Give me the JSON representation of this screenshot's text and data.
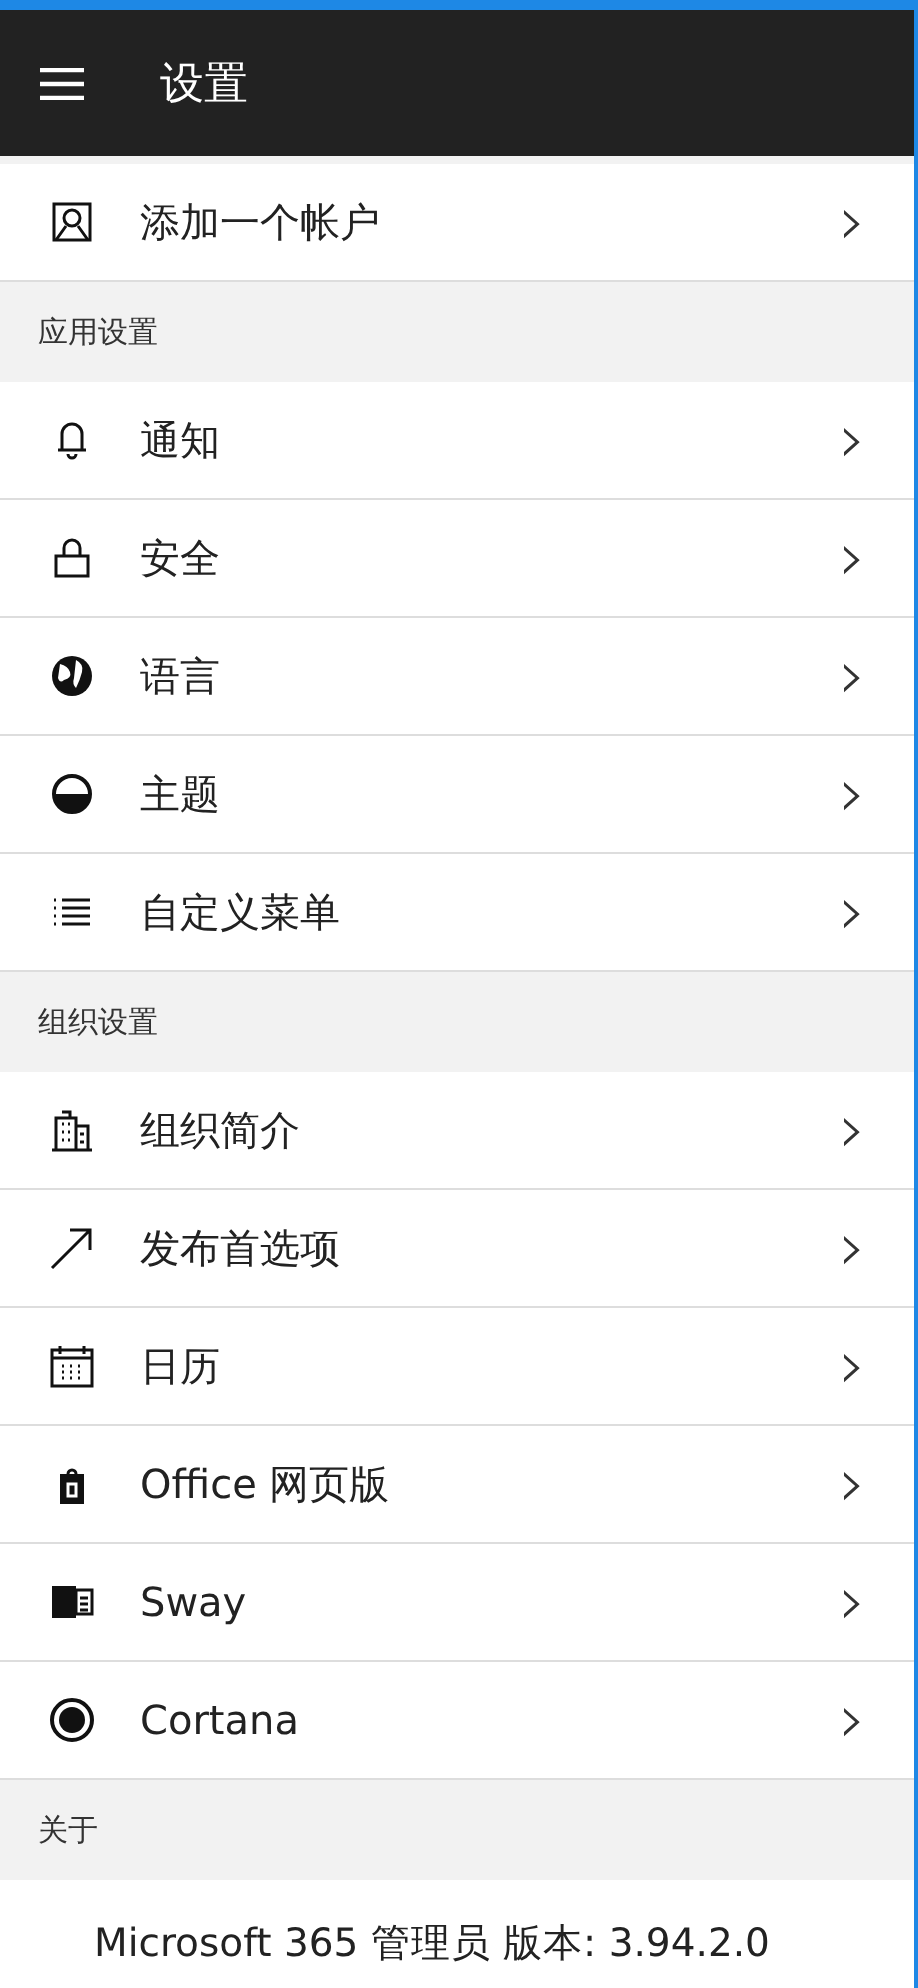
{
  "header": {
    "title": "设置"
  },
  "sections": [
    {
      "items": [
        {
          "label": "添加一个帐户",
          "chevron": "›"
        }
      ]
    },
    {
      "title": "应用设置",
      "items": [
        {
          "label": "通知",
          "chevron": "›"
        },
        {
          "label": "安全",
          "chevron": "›"
        },
        {
          "label": "语言",
          "chevron": "›"
        },
        {
          "label": "主题",
          "chevron": "›"
        },
        {
          "label": "自定义菜单",
          "chevron": "›"
        }
      ]
    },
    {
      "title": "组织设置",
      "items": [
        {
          "label": "组织简介",
          "chevron": "›"
        },
        {
          "label": "发布首选项",
          "chevron": "›"
        },
        {
          "label": "日历",
          "chevron": "›"
        },
        {
          "label": "Office 网页版",
          "chevron": "›"
        },
        {
          "label": "Sway",
          "chevron": "›"
        },
        {
          "label": "Cortana",
          "chevron": "›"
        }
      ]
    },
    {
      "title": "关于"
    }
  ],
  "version": "Microsoft 365 管理员 版本: 3.94.2.0"
}
